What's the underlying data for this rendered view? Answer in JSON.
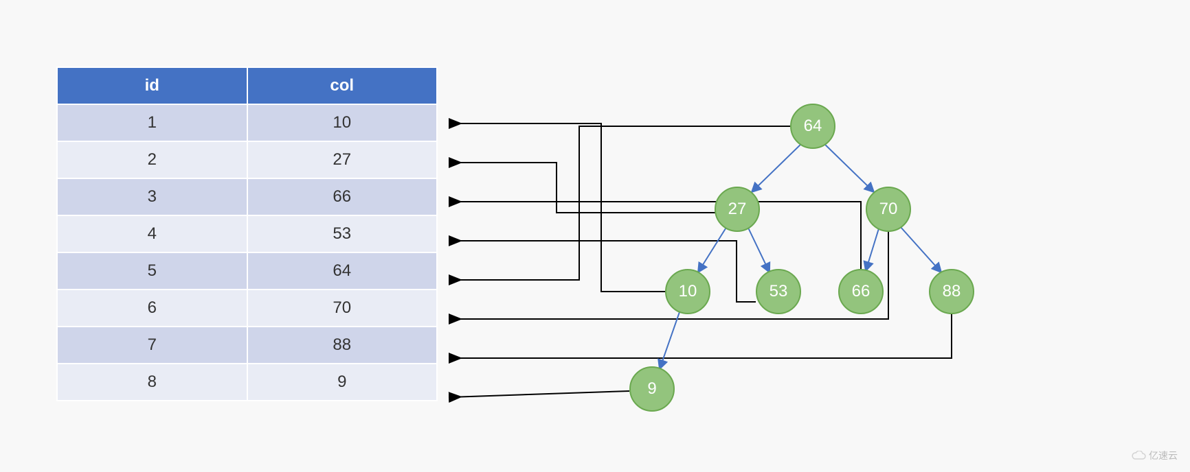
{
  "table": {
    "headers": {
      "id": "id",
      "col": "col"
    },
    "rows": [
      {
        "id": "1",
        "col": "10"
      },
      {
        "id": "2",
        "col": "27"
      },
      {
        "id": "3",
        "col": "66"
      },
      {
        "id": "4",
        "col": "53"
      },
      {
        "id": "5",
        "col": "64"
      },
      {
        "id": "6",
        "col": "70"
      },
      {
        "id": "7",
        "col": "88"
      },
      {
        "id": "8",
        "col": "9"
      }
    ]
  },
  "tree": {
    "nodes": {
      "root": "64",
      "l": "27",
      "r": "70",
      "ll": "10",
      "lr": "53",
      "rl": "66",
      "rr": "88",
      "lll": "9"
    }
  },
  "watermark": "亿速云"
}
